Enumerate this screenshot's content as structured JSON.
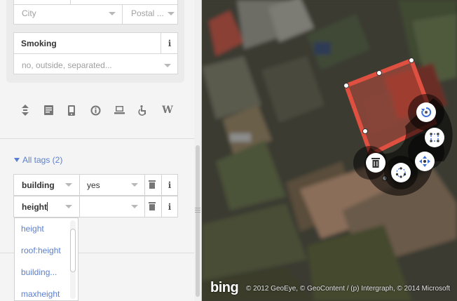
{
  "address": {
    "city_placeholder": "City",
    "postal_placeholder": "Postal ..."
  },
  "smoking": {
    "label": "Smoking",
    "info_label": "i",
    "placeholder": "no, outside, separated..."
  },
  "preset_icons": [
    "elevation-icon",
    "note-icon",
    "phone-icon",
    "info-circle-icon",
    "computer-icon",
    "wheelchair-icon",
    "wikipedia-icon"
  ],
  "wikipedia_glyph": "W",
  "all_tags": {
    "label": "All tags (2)"
  },
  "tags": [
    {
      "key": "building",
      "value": "yes",
      "info_label": "i"
    },
    {
      "key": "height",
      "value": "",
      "info_label": "i"
    }
  ],
  "suggestions": [
    "height",
    "roof:height",
    "building...",
    "maxheight"
  ],
  "map": {
    "logo": "bing",
    "attribution": "© 2012 GeoEye, © GeoContent / (p) Intergraph, © 2014 Microsoft"
  },
  "colors": {
    "link": "#5b7fd0",
    "selected_area": "#e05040",
    "panel_bg": "#f4f4f4"
  }
}
